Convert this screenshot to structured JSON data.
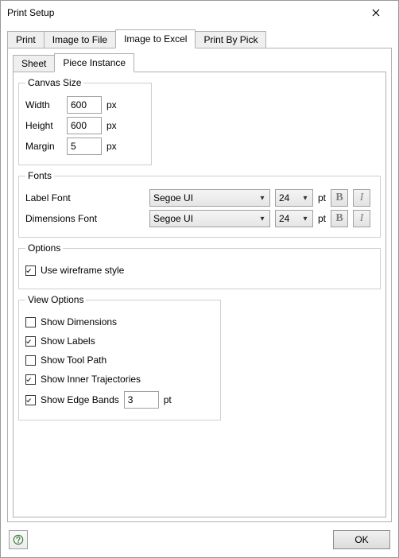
{
  "window": {
    "title": "Print Setup"
  },
  "tabs": {
    "print": "Print",
    "image_to_file": "Image to File",
    "image_to_excel": "Image to Excel",
    "print_by_pick": "Print By Pick"
  },
  "subtabs": {
    "sheet": "Sheet",
    "piece_instance": "Piece Instance"
  },
  "canvas": {
    "legend": "Canvas Size",
    "width_label": "Width",
    "width_value": "600",
    "height_label": "Height",
    "height_value": "600",
    "margin_label": "Margin",
    "margin_value": "5",
    "px_unit": "px"
  },
  "fonts": {
    "legend": "Fonts",
    "label_font_label": "Label Font",
    "label_font_value": "Segoe UI",
    "label_font_size": "24",
    "dims_font_label": "Dimensions Font",
    "dims_font_value": "Segoe UI",
    "dims_font_size": "24",
    "pt_unit": "pt",
    "bold_glyph": "B",
    "italic_glyph": "I"
  },
  "options": {
    "legend": "Options",
    "wireframe_label": "Use wireframe style",
    "wireframe_checked": true
  },
  "view": {
    "legend": "View Options",
    "show_dimensions_label": "Show Dimensions",
    "show_dimensions_checked": false,
    "show_labels_label": "Show Labels",
    "show_labels_checked": true,
    "show_tool_path_label": "Show Tool Path",
    "show_tool_path_checked": false,
    "show_inner_traj_label": "Show Inner Trajectories",
    "show_inner_traj_checked": true,
    "show_edge_bands_label": "Show Edge Bands",
    "show_edge_bands_checked": true,
    "show_edge_bands_value": "3",
    "pt_unit": "pt"
  },
  "footer": {
    "ok_label": "OK"
  }
}
